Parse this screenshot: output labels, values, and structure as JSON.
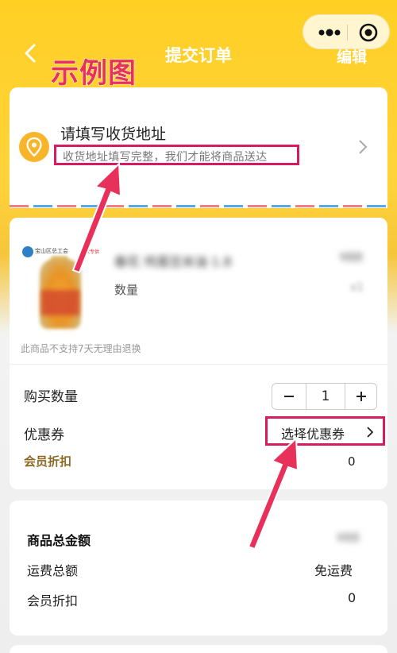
{
  "nav": {
    "title": "提交订单",
    "edit": "编辑",
    "example_label": "示例图"
  },
  "address": {
    "title": "请填写收货地址",
    "subtitle": "收货地址填写完整，我们才能将商品送达"
  },
  "product": {
    "shop_logo_text": "宝山区总工会",
    "tag_text": "爆款专供",
    "name": "春花 鸡蛋豆米油 1.8",
    "price": "¥88",
    "qty_label": "数量",
    "qty_value": "x1",
    "return_notice": "此商品不支持7天无理由退换"
  },
  "order": {
    "buy_qty_label": "购买数量",
    "qty": "1",
    "minus": "−",
    "plus": "+",
    "coupon_label": "优惠券",
    "coupon_action": "选择优惠券",
    "member_discount_label": "会员折扣",
    "member_discount_value": "0"
  },
  "summary": {
    "total_label": "商品总金额",
    "total_value": "¥88",
    "shipping_label": "运费总额",
    "shipping_value": "免运费",
    "discount_label": "会员折扣",
    "discount_value": "0"
  },
  "colors": {
    "header_yellow": "#ffcf24",
    "highlight_red": "#d81b60",
    "member_gold": "#8c6a23"
  },
  "icons": [
    "chevron-left-icon",
    "more-dots-icon",
    "target-icon",
    "location-pin-icon",
    "chevron-right-icon",
    "minus-icon",
    "plus-icon",
    "arrow-annotation"
  ]
}
